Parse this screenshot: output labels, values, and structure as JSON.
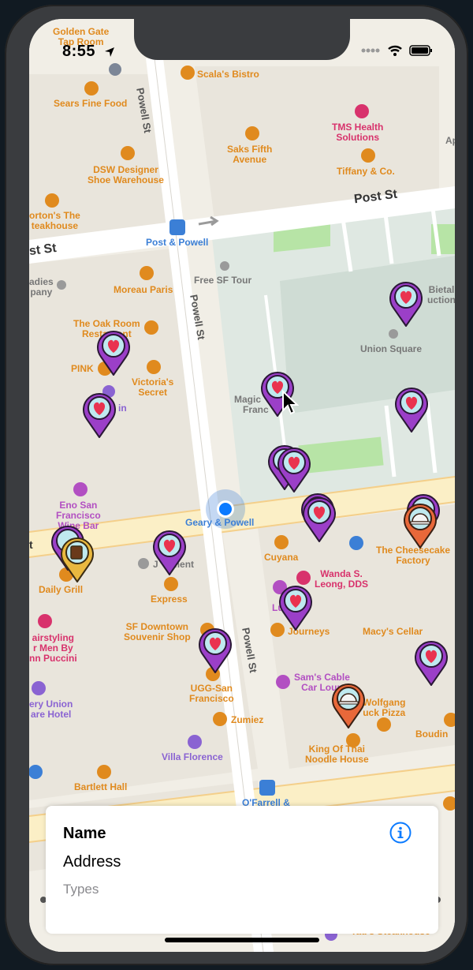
{
  "status_bar": {
    "time": "8:55"
  },
  "detail_card": {
    "name": "Name",
    "address": "Address",
    "types": "Types"
  },
  "streets": {
    "powell_top": "Powell St",
    "powell_mid": "Powell St",
    "powell_bottom": "Powell St",
    "post_right": "Post St",
    "post_left": "st St"
  },
  "transit": {
    "post_powell": "Post & Powell",
    "geary_powell": "Geary & Powell",
    "ofarrell": "O'Farrell &"
  },
  "pois": {
    "golden_gate": "Golden Gate\nTap Room",
    "scalas": "Scala's Bistro",
    "sears": "Sears Fine Food",
    "tms": "TMS Health\nSolutions",
    "saks": "Saks Fifth\nAvenue",
    "dsw": "DSW Designer\nShoe Warehouse",
    "tiffany": "Tiffany & Co.",
    "mortons": "orton's The\nteakhouse",
    "free_sf_tour": "Free SF Tour",
    "moreau": "Moreau Paris",
    "ladies": "adies\npany",
    "bietal": "Bietal\nuction",
    "union_square": "Union Square",
    "oak_room": "The Oak Room\nRestaurant",
    "pink": "PINK",
    "victorias": "Victoria's\nSecret",
    "magic": "Magic  an\nFranc",
    "in": "in",
    "eno": "Eno San\nFrancisco\nWine Bar",
    "daily_grill": "Daily Grill",
    "express": "Express",
    "j_ment": "J     ment",
    "cuyana": "Cuyana",
    "cheesecake": "The Cheesecake\nFactory",
    "wanda": "Wanda S.\nLeong, DDS",
    "lu": "Lu",
    "journeys": "Journeys",
    "macys": "Macy's Cellar",
    "sf_downtown": "SF Downtown\nSouvenir Shop",
    "airstyling": "airstyling\nr Men By\nnn Puccini",
    "sams": "Sam's Cable\nCar Loun",
    "ugg": "UGG-San\nFrancisco",
    "wolfgang": "Wolfgang\nuck Pizza",
    "ery_union": "ery Union\nare Hotel",
    "zumiez": "Zumiez",
    "king_of_thai": "King Of Thai\nNoodle House",
    "boudin": "Boudin",
    "villa": "Villa Florence",
    "bartlett": "Bartlett Hall",
    "taus": "Tad's Steakhouse",
    "t_left": "t",
    "ap": "Ap"
  },
  "colors": {
    "map_bg": "#f1eee6",
    "road": "#ffffff",
    "park": "#dde9dd",
    "major_road": "#fbefc6",
    "pin_purple": "#9b3fc8",
    "pin_orange": "#e8683a",
    "pin_yellow": "#e9b840",
    "poi_orange": "#e08a1e",
    "poi_pink": "#d8326c",
    "poi_blue": "#3b7fd6",
    "poi_purple": "#8a63d2",
    "accent_blue": "#0a7aff"
  }
}
